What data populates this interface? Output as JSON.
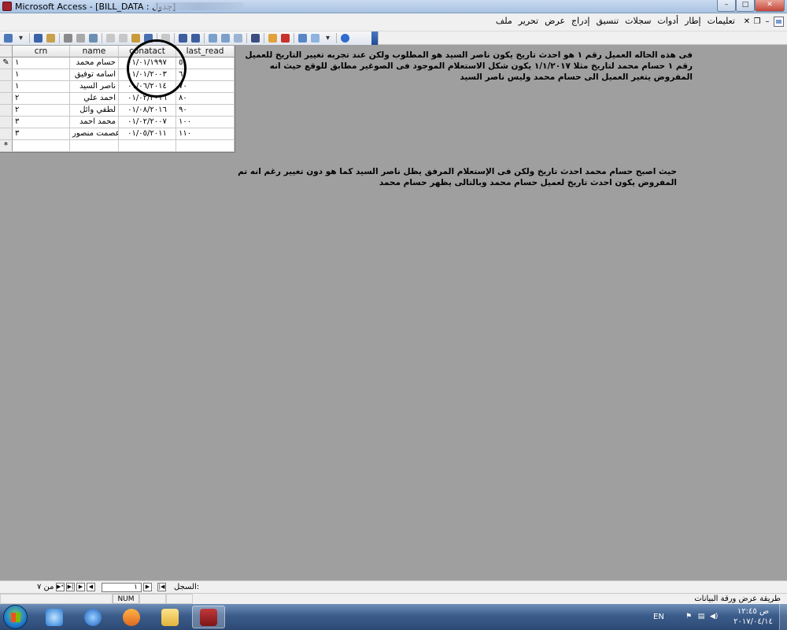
{
  "window": {
    "title": "Microsoft Access - [BILL_DATA : جدول]",
    "min_glyph": "–",
    "max_glyph": "□",
    "close_glyph": "✕"
  },
  "menu": {
    "items": [
      "ملف",
      "تحرير",
      "عرض",
      "إدراج",
      "تنسيق",
      "سجلات",
      "أدوات",
      "إطار",
      "تعليمات"
    ],
    "mdi_min": "–",
    "mdi_restore": "❐",
    "mdi_close": "✕"
  },
  "table": {
    "columns": [
      "crn",
      "name",
      "conatact",
      "last_read"
    ],
    "rows": [
      {
        "selector": "✎",
        "crn": "١",
        "name": "حسام محمد",
        "conatact": "٠١/٠١/١٩٩٧",
        "last_read": "٥٠"
      },
      {
        "selector": "",
        "crn": "١",
        "name": "اسامه توفيق",
        "conatact": "٠١/٠١/٢٠٠٣",
        "last_read": "٦٠"
      },
      {
        "selector": "",
        "crn": "١",
        "name": "ناصر السيد",
        "conatact": "٠١/٠٦/٢٠١٤",
        "last_read": "٧٠"
      },
      {
        "selector": "",
        "crn": "٢",
        "name": "احمد علي",
        "conatact": "٠١/٠٢/٢٠١٦",
        "last_read": "٨٠"
      },
      {
        "selector": "",
        "crn": "٢",
        "name": "لطفي وائل",
        "conatact": "٠١/٠٨/٢٠١٦",
        "last_read": "٩٠"
      },
      {
        "selector": "",
        "crn": "٣",
        "name": "محمد احمد",
        "conatact": "٠١/٠٢/٢٠٠٧",
        "last_read": "١٠٠"
      },
      {
        "selector": "",
        "crn": "٣",
        "name": "عصمت منصور",
        "conatact": "٠١/٠٥/٢٠١١",
        "last_read": "١١٠"
      }
    ],
    "new_row_marker": "*"
  },
  "annotations": {
    "note_1": "فى هذه الحاله العميل رقم ١ هو احدث تاريخ يكون ناصر السيد هو المطلوب ولكن عند تجربه تغيير التاريخ للعميل رقم ١ حسام محمد لتاريخ مثلا ١/١/٢٠١٧ يكون شكل الاستعلام الموجود فى الصوغير مطابق للوقع حيث انه المفروض يتغير العميل الى حسام محمد وليس ناصر السيد",
    "note_2": "حيث اصبح حسام محمد احدث تاريخ ولكن فى الإستعلام المرفق يظل ناصر السيد كما هو دون تغيير رغم انه تم المفروض يكون احدث تاريخ لعميل حسام محمد وبالتالى يظهر حسام محمد"
  },
  "navigation": {
    "label": "السجل:",
    "current": "١",
    "total_text": "من ٧",
    "first": "|◀",
    "prev": "◀",
    "next": "▶",
    "last": "▶|",
    "new": "▶*"
  },
  "statusbar": {
    "text": "طريقة عرض ورقة البيانات",
    "num": "NUM"
  },
  "taskbar": {
    "language": "EN",
    "time": "ص ١٢:٤٥",
    "date": "٢٠١٧/٠٤/١٤"
  },
  "icons": {
    "app": "access-icon",
    "taskbar": [
      "start-orb-icon",
      "messenger-icon",
      "internet-explorer-icon",
      "media-player-icon",
      "folder-icon",
      "access-taskbar-icon"
    ],
    "tray": [
      "flag-icon",
      "network-icon",
      "volume-icon"
    ]
  },
  "colors": {
    "workspace": "#9f9f9f",
    "titlebar": "#b9cde8",
    "taskbar": "#3b5c8a",
    "access_brand": "#a0222c"
  }
}
